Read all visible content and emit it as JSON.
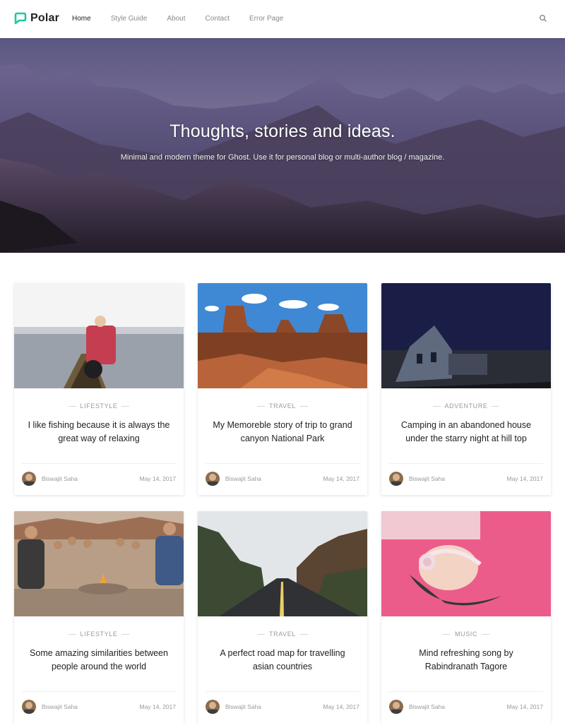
{
  "brand": {
    "name": "Polar",
    "accent": "#1ec9a1"
  },
  "nav": [
    {
      "label": "Home",
      "active": true
    },
    {
      "label": "Style Guide",
      "active": false
    },
    {
      "label": "About",
      "active": false
    },
    {
      "label": "Contact",
      "active": false
    },
    {
      "label": "Error Page",
      "active": false
    }
  ],
  "search": {
    "icon": "search-icon"
  },
  "hero": {
    "title": "Thoughts, stories and ideas.",
    "subtitle": "Minimal and modern theme for Ghost. Use it for personal blog or multi-author blog / magazine."
  },
  "posts": [
    {
      "category": "LIFESTYLE",
      "title": "I like fishing because it is always the great way of relaxing",
      "author": "Biswajit Saha",
      "date": "May 14, 2017"
    },
    {
      "category": "TRAVEL",
      "title": "My Memoreble story of trip to grand canyon National Park",
      "author": "Biswajit Saha",
      "date": "May 14, 2017"
    },
    {
      "category": "ADVENTURE",
      "title": "Camping in an abandoned house under the starry night at hill top",
      "author": "Biswajit Saha",
      "date": "May 14, 2017"
    },
    {
      "category": "LIFESTYLE",
      "title": "Some amazing similarities between people around the world",
      "author": "Biswajit Saha",
      "date": "May 14, 2017"
    },
    {
      "category": "TRAVEL",
      "title": "A perfect road map for travelling asian countries",
      "author": "Biswajit Saha",
      "date": "May 14, 2017"
    },
    {
      "category": "MUSIC",
      "title": "Mind refreshing song by Rabindranath Tagore",
      "author": "Biswajit Saha",
      "date": "May 14, 2017"
    }
  ]
}
